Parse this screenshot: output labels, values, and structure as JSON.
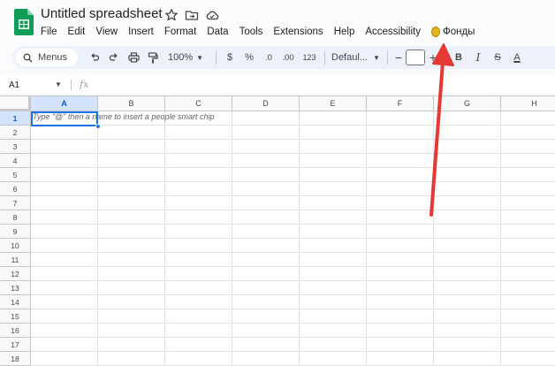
{
  "title": "Untitled spreadsheet",
  "menu": [
    "File",
    "Edit",
    "View",
    "Insert",
    "Format",
    "Data",
    "Tools",
    "Extensions",
    "Help",
    "Accessibility"
  ],
  "funds_menu": "Фонды",
  "toolbar": {
    "menus_label": "Menus",
    "zoom": "100%",
    "currency": "$",
    "percent": "%",
    "decrease_decimal": ".0",
    "increase_decimal": ".00",
    "number_format": "123",
    "font": "Defaul...",
    "minus": "−",
    "plus": "+",
    "bold": "B",
    "italic": "I",
    "strike": "S",
    "text_color": "A"
  },
  "formula_bar": {
    "cell_ref": "A1",
    "fx": "fx"
  },
  "columns": [
    "A",
    "B",
    "C",
    "D",
    "E",
    "F",
    "G",
    "H"
  ],
  "rows": [
    "1",
    "2",
    "3",
    "4",
    "5",
    "6",
    "7",
    "8",
    "9",
    "10",
    "11",
    "12",
    "13",
    "14",
    "15",
    "16",
    "17",
    "18"
  ],
  "active_cell_hint": "Type \"@\" then a name to insert a people smart chip",
  "colors": {
    "accent": "#1a73e8",
    "arrow": "#e53935",
    "sheets_green": "#0f9d58"
  },
  "icons": [
    "sheets-logo-icon",
    "star-icon",
    "move-to-folder-icon",
    "cloud-saved-icon",
    "coin-icon",
    "search-icon",
    "undo-icon",
    "redo-icon",
    "print-icon",
    "paint-format-icon",
    "chevron-down-icon"
  ]
}
